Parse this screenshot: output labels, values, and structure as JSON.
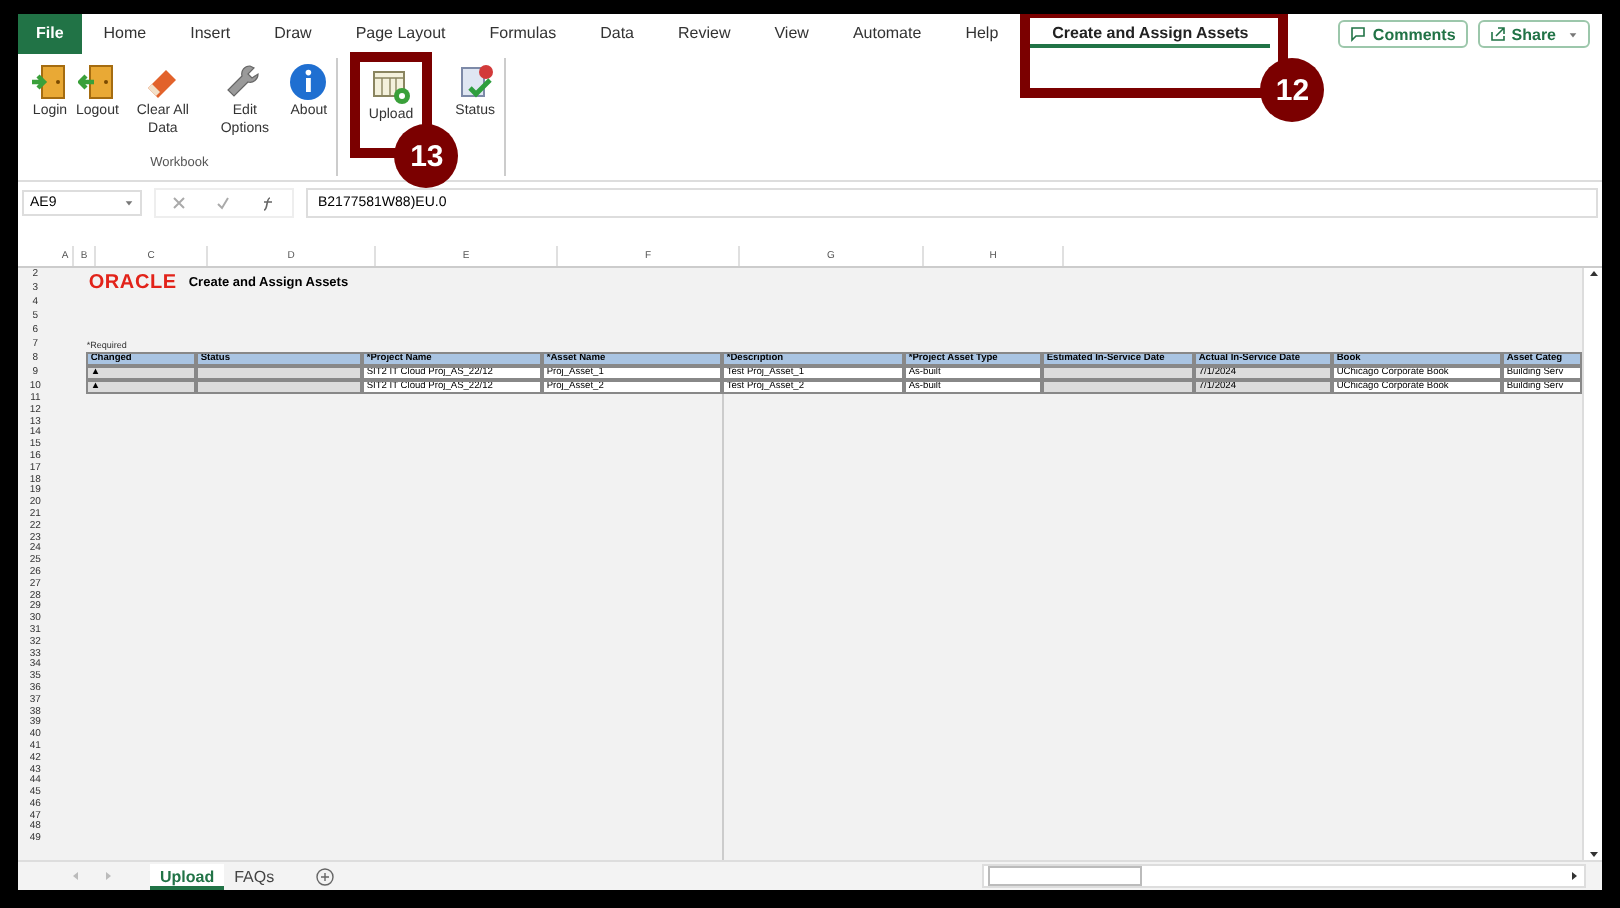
{
  "ribbon_tabs": [
    {
      "label": "File",
      "kind": "file",
      "selected": false
    },
    {
      "label": "Home",
      "kind": "tab",
      "selected": false
    },
    {
      "label": "Insert",
      "kind": "tab",
      "selected": false
    },
    {
      "label": "Draw",
      "kind": "tab",
      "selected": false
    },
    {
      "label": "Page Layout",
      "kind": "tab",
      "selected": false
    },
    {
      "label": "Formulas",
      "kind": "tab",
      "selected": false
    },
    {
      "label": "Data",
      "kind": "tab",
      "selected": false
    },
    {
      "label": "Review",
      "kind": "tab",
      "selected": false
    },
    {
      "label": "View",
      "kind": "tab",
      "selected": false
    },
    {
      "label": "Automate",
      "kind": "tab",
      "selected": false
    },
    {
      "label": "Help",
      "kind": "tab",
      "selected": false
    },
    {
      "label": "Create and Assign Assets",
      "kind": "tab",
      "selected": true,
      "callout": "12"
    }
  ],
  "header_buttons": [
    {
      "label": "Comments",
      "kind": "comments"
    },
    {
      "label": "Share",
      "kind": "share"
    }
  ],
  "ribbon_groups": [
    {
      "label": "Workbook",
      "buttons": [
        {
          "label": "Login",
          "kind": "door-in"
        },
        {
          "label": "Logout",
          "kind": "door-out"
        },
        {
          "label": "Clear All Data",
          "kind": "eraser"
        },
        {
          "label": "Edit Options",
          "kind": "wrench"
        },
        {
          "label": "About",
          "kind": "info"
        }
      ]
    },
    {
      "buttons": [
        {
          "label": "Upload",
          "kind": "sheet-gear",
          "callout": "13"
        },
        {
          "label": "Status",
          "kind": "doc-check"
        }
      ]
    }
  ],
  "name_box": "AE9",
  "formula": "B2177581W88)EU.0",
  "column_letters": [
    "A",
    "B",
    "C",
    "D",
    "E",
    "F",
    "G",
    "H"
  ],
  "row_numbers": [
    "2",
    "3",
    "4",
    "5",
    "6",
    "7",
    "8",
    "9",
    "10",
    "11",
    "12",
    "13",
    "14",
    "15",
    "16",
    "17",
    "18",
    "19",
    "20",
    "21",
    "22",
    "23",
    "24",
    "25",
    "26",
    "27",
    "28",
    "29",
    "30",
    "31",
    "32",
    "33",
    "34",
    "35",
    "36",
    "37",
    "38",
    "39",
    "40",
    "41",
    "42",
    "43",
    "44",
    "45",
    "46",
    "47",
    "48",
    "49"
  ],
  "sheet_title": {
    "logo": "ORACLE",
    "title": "Create and Assign Assets"
  },
  "required_note": "*Required",
  "table": {
    "columns": [
      {
        "label": "Changed",
        "locked": true
      },
      {
        "label": "Status",
        "locked": true
      },
      {
        "label": "*Project Name",
        "locked": false
      },
      {
        "label": "*Asset Name",
        "locked": false
      },
      {
        "label": "*Description",
        "locked": false
      },
      {
        "label": "*Project Asset Type",
        "locked": false
      },
      {
        "label": "Estimated In-Service Date",
        "locked": true
      },
      {
        "label": "Actual In-Service Date",
        "locked": true
      },
      {
        "label": "Book",
        "locked": false
      },
      {
        "label": "Asset Categ",
        "locked": false
      }
    ],
    "rows": [
      [
        "▲",
        "",
        "SIT2 IT Cloud Proj_AS_22/12",
        "Proj_Asset_1",
        "Test Proj_Asset_1",
        "As-built",
        "",
        "7/1/2024",
        "UChicago Corporate Book",
        "Building Serv"
      ],
      [
        "▲",
        "",
        "SIT2 IT Cloud Proj_AS_22/12",
        "Proj_Asset_2",
        "Test Proj_Asset_2",
        "As-built",
        "",
        "7/1/2024",
        "UChicago Corporate Book",
        "Building Serv"
      ]
    ]
  },
  "sheet_tabs": [
    {
      "label": "Upload",
      "selected": true
    },
    {
      "label": "FAQs",
      "selected": false
    }
  ]
}
